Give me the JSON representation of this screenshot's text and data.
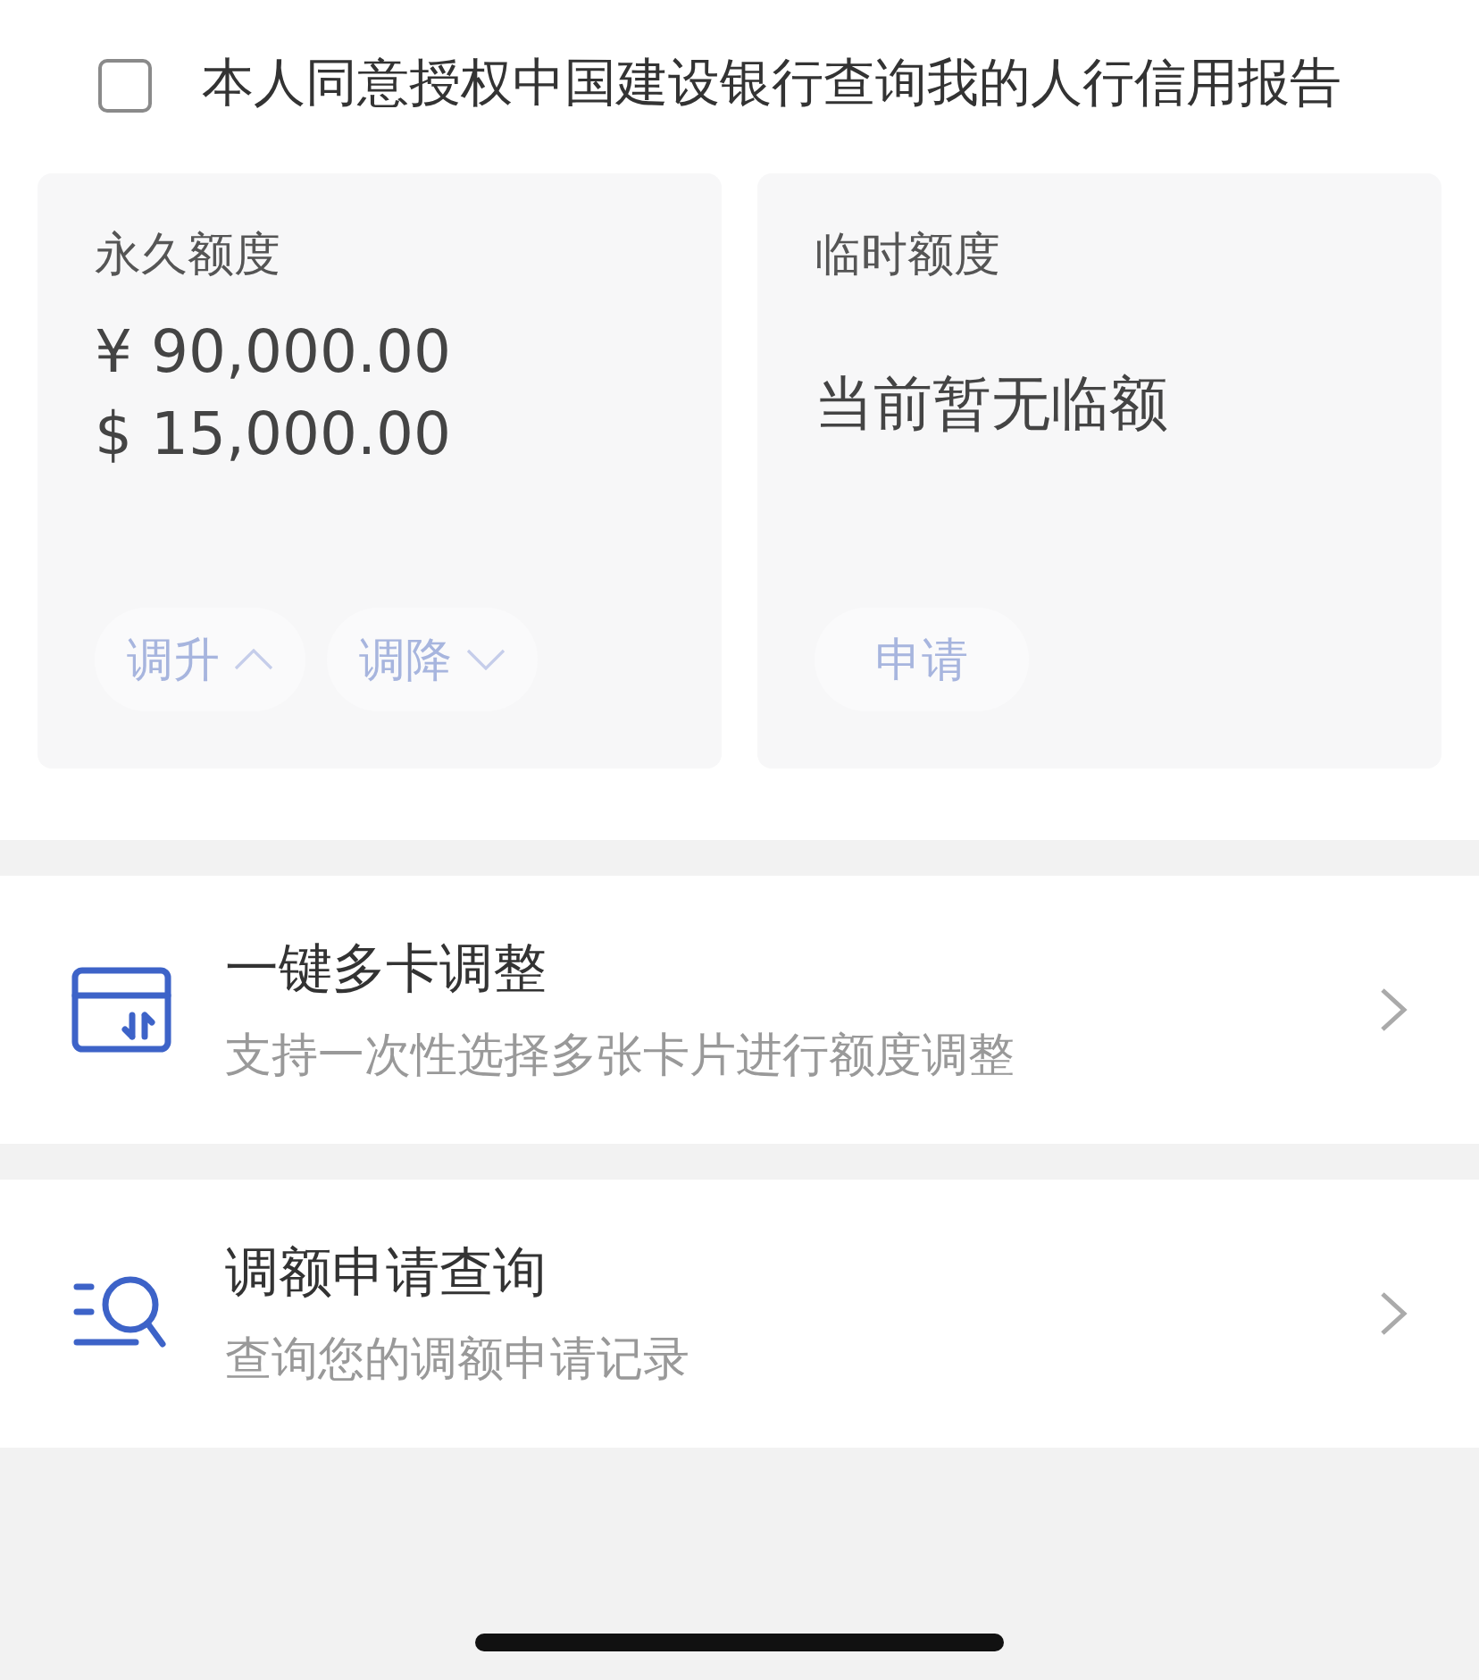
{
  "consent": {
    "checked": false,
    "text": "本人同意授权中国建设银行查询我的人行信用报告"
  },
  "cards": [
    {
      "kind": "permanent",
      "title": "永久额度",
      "amounts": [
        "¥ 90,000.00",
        "$ 15,000.00"
      ],
      "buttons": [
        {
          "label": "调升",
          "kind": "up",
          "disabled": true
        },
        {
          "label": "调降",
          "kind": "down",
          "disabled": true
        }
      ]
    },
    {
      "kind": "temporary",
      "title": "临时额度",
      "message": "当前暂无临额",
      "buttons": [
        {
          "label": "申请",
          "kind": "plain",
          "disabled": true
        }
      ]
    }
  ],
  "menu": [
    {
      "kind": "cards",
      "title": "一键多卡调整",
      "subtitle": "支持一次性选择多张卡片进行额度调整"
    },
    {
      "kind": "query",
      "title": "调额申请查询",
      "subtitle": "查询您的调额申请记录"
    }
  ]
}
